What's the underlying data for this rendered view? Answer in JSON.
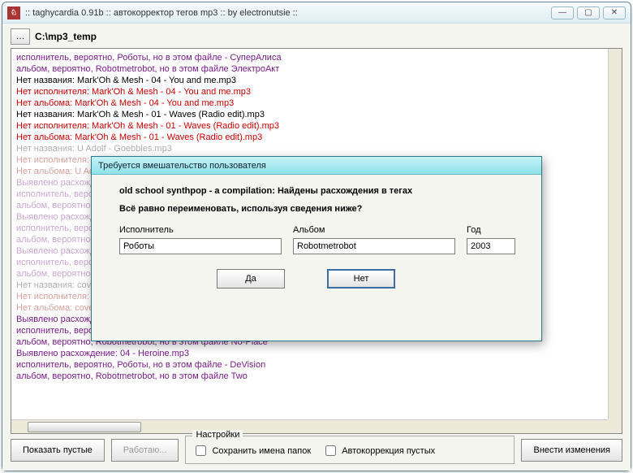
{
  "window": {
    "title": ":: taghycardia 0.91b :: автокорректор тегов mp3 :: by electronutsie ::",
    "path_label": "C:\\mp3_temp"
  },
  "log": [
    {
      "cls": "c-purple",
      "t": "  исполнитель, вероятно, Роботы, но в этом файле - СуперАлиса"
    },
    {
      "cls": "c-purple",
      "t": "  альбом, вероятно, Robotmetrobot, но в этом файле ЭлектроАкт"
    },
    {
      "cls": "c-black",
      "t": "Нет названия: Mark'Oh & Mesh - 04 - You and me.mp3"
    },
    {
      "cls": "c-red",
      "t": "Нет исполнителя: Mark'Oh & Mesh - 04 - You and me.mp3"
    },
    {
      "cls": "c-red",
      "t": "Нет альбома: Mark'Oh & Mesh - 04 - You and me.mp3"
    },
    {
      "cls": "c-black",
      "t": "Нет названия: Mark'Oh & Mesh - 01 - Waves (Radio edit).mp3"
    },
    {
      "cls": "c-red",
      "t": "Нет исполнителя: Mark'Oh & Mesh - 01 - Waves (Radio edit).mp3"
    },
    {
      "cls": "c-red",
      "t": "Нет альбома: Mark'Oh & Mesh - 01 - Waves (Radio edit).mp3"
    },
    {
      "cls": "c-gray",
      "t": "Нет названия: U Adolf - Goebbles.mp3"
    },
    {
      "cls": "c-redgray",
      "t": "Нет исполнителя: U Adolf - Goebbles.mp3"
    },
    {
      "cls": "c-redgray",
      "t": "Нет альбома: U Adolf - Goebbles.mp3"
    },
    {
      "cls": "c-purplegray",
      "t": "Выявлено расхождение: Роботы - 02 - Стоп (Svet Dalekoj Zvezdi).mp3"
    },
    {
      "cls": "c-purplegray",
      "t": "  исполнитель, вероятно, Роботы, но в этом файле - DeVision"
    },
    {
      "cls": "c-purplegray",
      "t": "  альбом, вероятно, Robotmetrobot, но в этом файле unsorted"
    },
    {
      "cls": "c-purplegray",
      "t": "Выявлено расхождение: Роботы - 03 - Стоп (Svet Dalekoj Zvezdi).mp3"
    },
    {
      "cls": "c-purplegray",
      "t": "  исполнитель, вероятно, Роботы, но в этом файле - DeMARSH"
    },
    {
      "cls": "c-purplegray",
      "t": "  альбом, вероятно, Robotmetrobot, но в этом файле unsorted"
    },
    {
      "cls": "c-purplegray",
      "t": "Выявлено расхождение: Das Ich - Destillat (VNV Nation Remix).mp3"
    },
    {
      "cls": "c-purplegray",
      "t": "  исполнитель, вероятно, Роботы, но в этом файле - Das Ich"
    },
    {
      "cls": "c-purplegray",
      "t": "  альбом, вероятно, Robotmetrobot, но в этом файле Laborat"
    },
    {
      "cls": "c-gray",
      "t": "Нет названия: covenant - Theremin.mp3"
    },
    {
      "cls": "c-redgray",
      "t": "Нет исполнителя: covenant - Theremin.mp3"
    },
    {
      "cls": "c-redgray",
      "t": "Нет альбома: covenant - Theremin.mp3"
    },
    {
      "cls": "c-purple",
      "t": "Выявлено расхождение: belief - the 7th day.mp3"
    },
    {
      "cls": "c-purple",
      "t": "  исполнитель, вероятно, Роботы, но в этом файле - Belief"
    },
    {
      "cls": "c-purple",
      "t": "  альбом, вероятно, Robotmetrobot, но в этом файле No-Place"
    },
    {
      "cls": "c-purple",
      "t": "Выявлено расхождение: 04 - Heroine.mp3"
    },
    {
      "cls": "c-purple",
      "t": "  исполнитель, вероятно, Роботы, но в этом файле - DeVision"
    },
    {
      "cls": "c-purple",
      "t": "  альбом, вероятно, Robotmetrobot, но в этом файле Two"
    }
  ],
  "buttons": {
    "show_empty": "Показать пустые",
    "working": "Работаю...",
    "apply": "Внести изменения"
  },
  "settings": {
    "legend": "Настройки",
    "keep_folder_names": "Сохранить имена папок",
    "autocorrect_empty": "Автокоррекция пустых"
  },
  "dialog": {
    "title": "Требуется вмешательство пользователя",
    "heading": "old school synthpop - a compilation: Найдены расхождения в тегах",
    "subheading": "Всё равно переименовать, используя сведения ниже?",
    "labels": {
      "artist": "Исполнитель",
      "album": "Альбом",
      "year": "Год"
    },
    "values": {
      "artist": "Роботы",
      "album": "Robotmetrobot",
      "year": "2003"
    },
    "yes": "Да",
    "no": "Нет"
  }
}
